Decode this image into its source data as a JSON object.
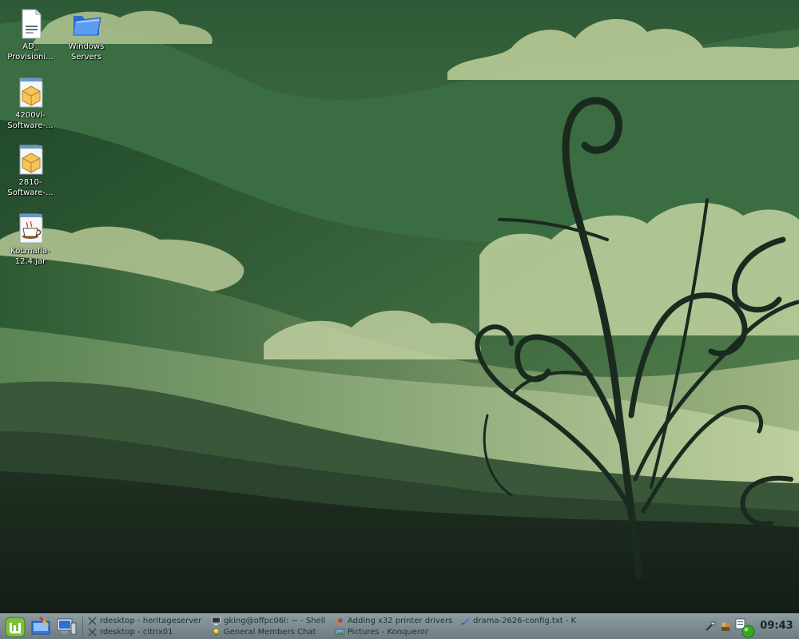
{
  "desktop": {
    "icons": [
      {
        "label_line1": "AD_",
        "label_line2": "Provisioni...",
        "icon": "document-icon"
      },
      {
        "label_line1": "Windows",
        "label_line2": "Servers",
        "icon": "folder-icon"
      },
      {
        "label_line1": "4200vl-",
        "label_line2": "Software-...",
        "icon": "package-icon"
      },
      {
        "label_line1": "2810-",
        "label_line2": "Software-...",
        "icon": "package-icon"
      },
      {
        "label_line1": "KoLmafia-",
        "label_line2": "12.4.jar",
        "icon": "java-jar-icon"
      }
    ]
  },
  "taskbar": {
    "launchers": [
      {
        "name": "start-menu",
        "icon": "mint-logo-icon"
      },
      {
        "name": "show-desktop",
        "icon": "show-desktop-icon"
      },
      {
        "name": "system-settings",
        "icon": "computer-icon"
      }
    ],
    "tasks": [
      {
        "label": "rdesktop - heritageserver",
        "icon": "rdesktop-icon"
      },
      {
        "label": "rdesktop - citrix01",
        "icon": "rdesktop-icon"
      },
      {
        "label": "gking@offpc06l: ~ - Shell",
        "icon": "terminal-icon"
      },
      {
        "label": "General Members Chat",
        "icon": "chat-icon"
      },
      {
        "label": "Adding x32 printer drivers",
        "icon": "browser-icon"
      },
      {
        "label": "Pictures - Konqueror",
        "icon": "konqueror-icon"
      },
      {
        "label": "drama-2626-config.txt - K",
        "icon": "text-editor-icon"
      }
    ],
    "tray": [
      {
        "name": "network",
        "icon": "network-icon"
      },
      {
        "name": "messenger",
        "icon": "messenger-icon"
      },
      {
        "name": "clipboard",
        "icon": "clipboard-icon"
      },
      {
        "name": "status",
        "icon": "status-online-icon"
      }
    ],
    "clock": "09:43"
  },
  "colors": {
    "sky_top": "#2f5c37",
    "mountain_dark": "#1e2f22",
    "cloud": "#c2d1a0",
    "taskbar": "#7f8e93",
    "accent_green": "#33aa22"
  }
}
